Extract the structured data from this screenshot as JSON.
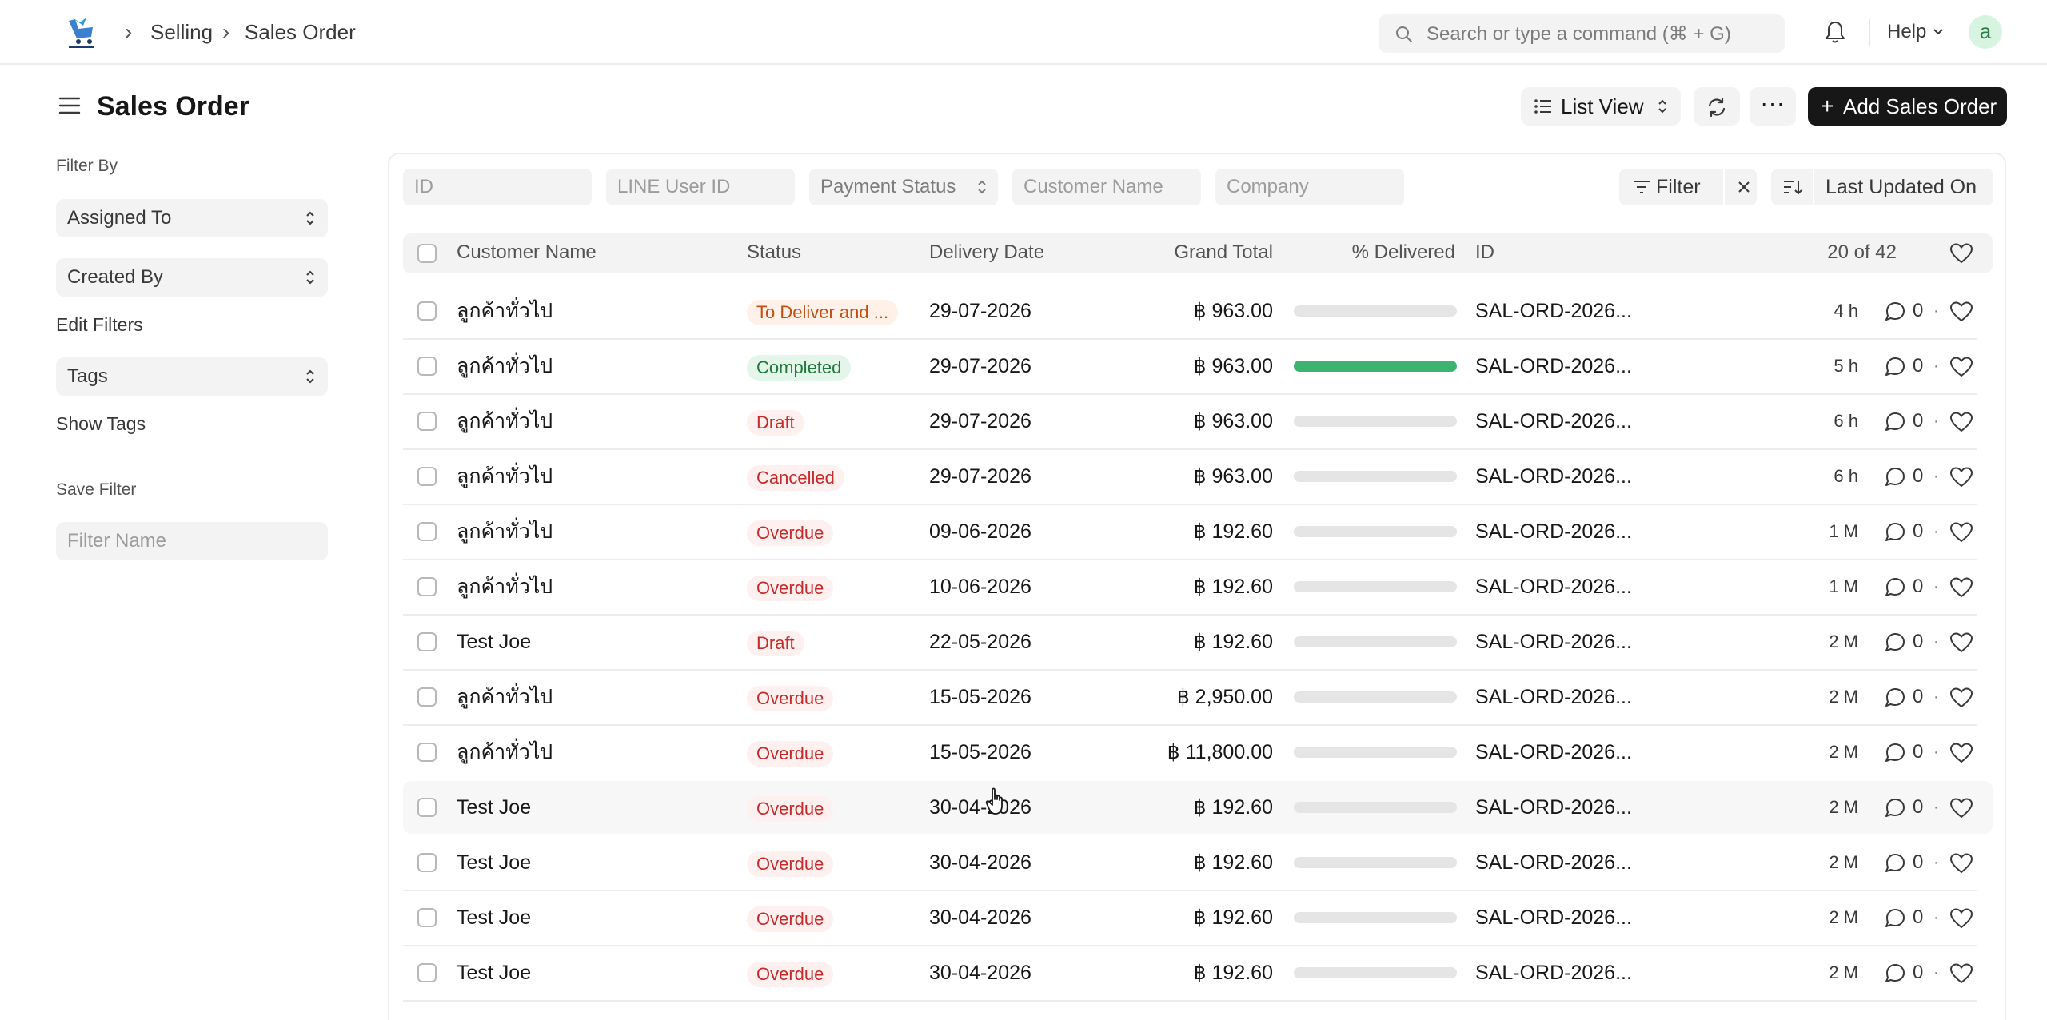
{
  "breadcrumb": {
    "items": [
      "Selling",
      "Sales Order"
    ]
  },
  "search": {
    "placeholder": "Search or type a command (⌘ + G)"
  },
  "help": {
    "label": "Help"
  },
  "user": {
    "avatar_letter": "a"
  },
  "page": {
    "title": "Sales Order"
  },
  "toolbar": {
    "view_label": "List View",
    "more_label": "···",
    "add_label": "Add Sales Order"
  },
  "sidebar": {
    "filter_by_label": "Filter By",
    "assigned_to": "Assigned To",
    "created_by": "Created By",
    "edit_filters": "Edit Filters",
    "tags": "Tags",
    "show_tags": "Show Tags",
    "save_filter_label": "Save Filter",
    "filter_name_placeholder": "Filter Name"
  },
  "filters": {
    "id_placeholder": "ID",
    "line_user_placeholder": "LINE User ID",
    "payment_status": "Payment Status",
    "customer_name_placeholder": "Customer Name",
    "company_placeholder": "Company",
    "filter_label": "Filter",
    "sort_label": "Last Updated On"
  },
  "list": {
    "columns": [
      "Customer Name",
      "Status",
      "Delivery Date",
      "Grand Total",
      "% Delivered",
      "ID"
    ],
    "count": "20 of 42",
    "rows": [
      {
        "customer": "ลูกค้าทั่วไป",
        "status": "To Deliver and ...",
        "status_color": "orange",
        "date": "29-07-2026",
        "total": "฿ 963.00",
        "delivered": 0,
        "id": "SAL-ORD-2026...",
        "modified": "4 h",
        "comments": "0"
      },
      {
        "customer": "ลูกค้าทั่วไป",
        "status": "Completed",
        "status_color": "green",
        "date": "29-07-2026",
        "total": "฿ 963.00",
        "delivered": 100,
        "id": "SAL-ORD-2026...",
        "modified": "5 h",
        "comments": "0"
      },
      {
        "customer": "ลูกค้าทั่วไป",
        "status": "Draft",
        "status_color": "red",
        "date": "29-07-2026",
        "total": "฿ 963.00",
        "delivered": 0,
        "id": "SAL-ORD-2026...",
        "modified": "6 h",
        "comments": "0"
      },
      {
        "customer": "ลูกค้าทั่วไป",
        "status": "Cancelled",
        "status_color": "red",
        "date": "29-07-2026",
        "total": "฿ 963.00",
        "delivered": 0,
        "id": "SAL-ORD-2026...",
        "modified": "6 h",
        "comments": "0"
      },
      {
        "customer": "ลูกค้าทั่วไป",
        "status": "Overdue",
        "status_color": "red",
        "date": "09-06-2026",
        "total": "฿ 192.60",
        "delivered": 0,
        "id": "SAL-ORD-2026...",
        "modified": "1 M",
        "comments": "0"
      },
      {
        "customer": "ลูกค้าทั่วไป",
        "status": "Overdue",
        "status_color": "red",
        "date": "10-06-2026",
        "total": "฿ 192.60",
        "delivered": 0,
        "id": "SAL-ORD-2026...",
        "modified": "1 M",
        "comments": "0"
      },
      {
        "customer": "Test Joe",
        "status": "Draft",
        "status_color": "red",
        "date": "22-05-2026",
        "total": "฿ 192.60",
        "delivered": 0,
        "id": "SAL-ORD-2026...",
        "modified": "2 M",
        "comments": "0"
      },
      {
        "customer": "ลูกค้าทั่วไป",
        "status": "Overdue",
        "status_color": "red",
        "date": "15-05-2026",
        "total": "฿ 2,950.00",
        "delivered": 0,
        "id": "SAL-ORD-2026...",
        "modified": "2 M",
        "comments": "0"
      },
      {
        "customer": "ลูกค้าทั่วไป",
        "status": "Overdue",
        "status_color": "red",
        "date": "15-05-2026",
        "total": "฿ 11,800.00",
        "delivered": 0,
        "id": "SAL-ORD-2026...",
        "modified": "2 M",
        "comments": "0"
      },
      {
        "customer": "Test Joe",
        "status": "Overdue",
        "status_color": "red",
        "date": "30-04-2026",
        "total": "฿ 192.60",
        "delivered": 0,
        "id": "SAL-ORD-2026...",
        "modified": "2 M",
        "comments": "0"
      },
      {
        "customer": "Test Joe",
        "status": "Overdue",
        "status_color": "red",
        "date": "30-04-2026",
        "total": "฿ 192.60",
        "delivered": 0,
        "id": "SAL-ORD-2026...",
        "modified": "2 M",
        "comments": "0"
      },
      {
        "customer": "Test Joe",
        "status": "Overdue",
        "status_color": "red",
        "date": "30-04-2026",
        "total": "฿ 192.60",
        "delivered": 0,
        "id": "SAL-ORD-2026...",
        "modified": "2 M",
        "comments": "0"
      },
      {
        "customer": "Test Joe",
        "status": "Overdue",
        "status_color": "red",
        "date": "30-04-2026",
        "total": "฿ 192.60",
        "delivered": 0,
        "id": "SAL-ORD-2026...",
        "modified": "2 M",
        "comments": "0"
      }
    ]
  }
}
